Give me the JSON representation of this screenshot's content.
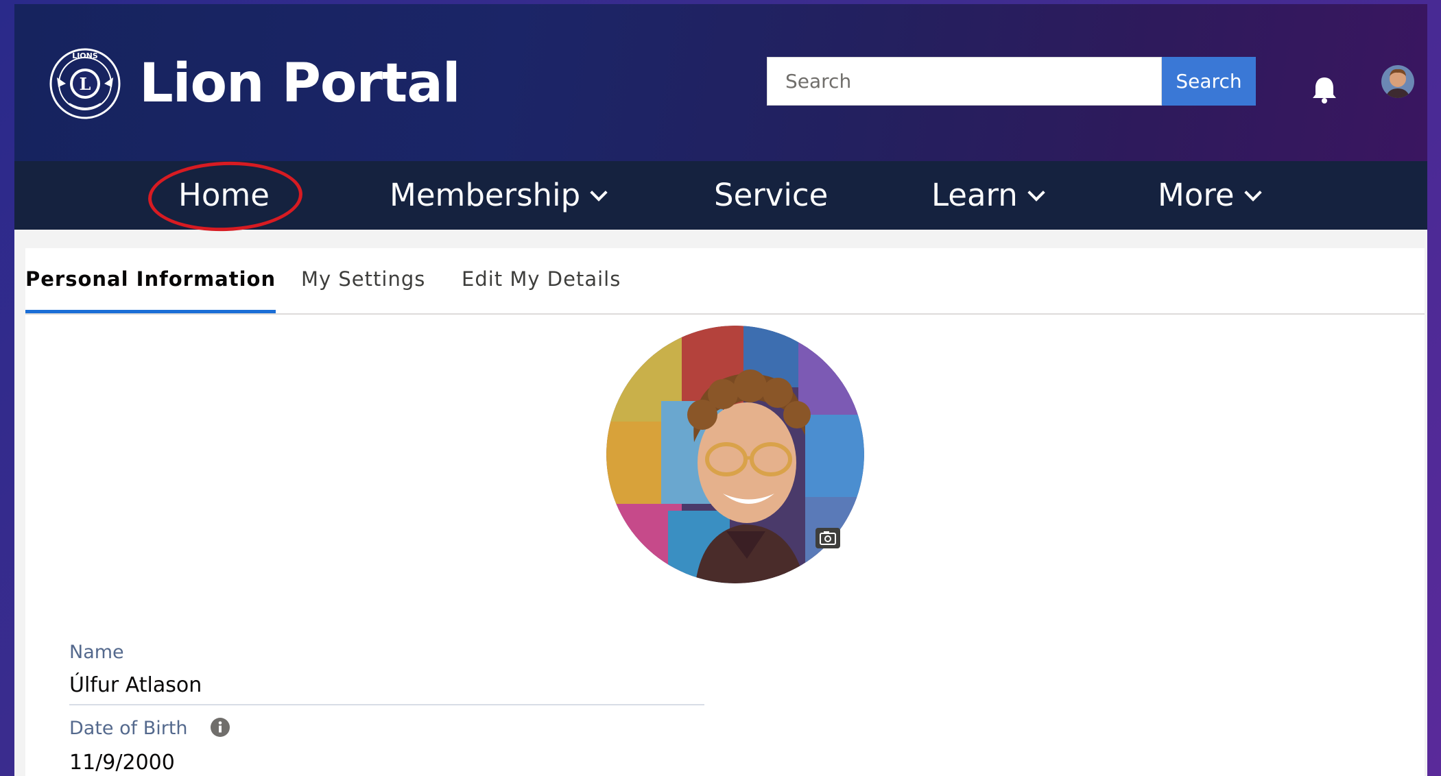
{
  "header": {
    "logo_title": "Lion Portal",
    "logo_seal_text": "LIONS",
    "search": {
      "placeholder": "Search",
      "button_label": "Search"
    },
    "notifications_icon": "bell-icon",
    "user_avatar": "user-avatar"
  },
  "nav": {
    "items": [
      {
        "label": "Home",
        "has_dropdown": false,
        "highlighted": true
      },
      {
        "label": "Membership",
        "has_dropdown": true
      },
      {
        "label": "Service",
        "has_dropdown": false
      },
      {
        "label": "Learn",
        "has_dropdown": true
      },
      {
        "label": "More",
        "has_dropdown": true
      }
    ],
    "highlight_color": "#d71b22"
  },
  "tabs": [
    {
      "label": "Personal Information",
      "active": true
    },
    {
      "label": "My Settings",
      "active": false
    },
    {
      "label": "Edit My Details",
      "active": false
    }
  ],
  "profile": {
    "photo_icon": "camera-icon",
    "fields": [
      {
        "label": "Name",
        "value": "Úlfur Atlason"
      },
      {
        "label": "Date of Birth",
        "value": "11/9/2000",
        "info_icon": "info-icon"
      }
    ]
  },
  "colors": {
    "header_bg": "#1b2567",
    "nav_bg": "#15223f",
    "search_button": "#3a78d6",
    "active_tab_underline": "#1b6ed6"
  }
}
